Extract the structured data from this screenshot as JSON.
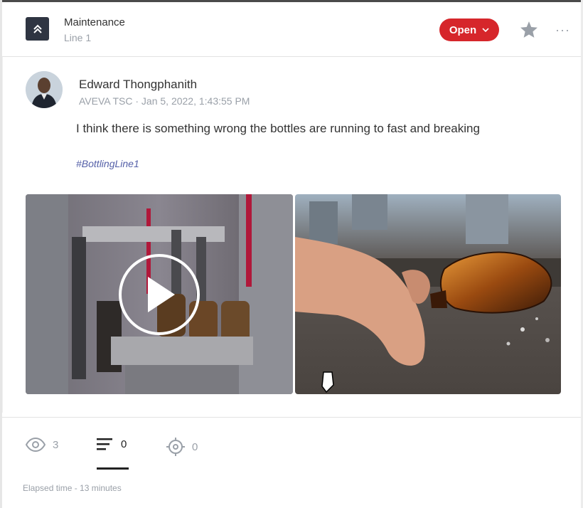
{
  "header": {
    "title": "Maintenance",
    "subtitle": "Line 1",
    "collapse_icon": "double-chevron-up-icon",
    "status_label": "Open",
    "status_color": "#d6262b",
    "star_icon": "star-icon",
    "more_label": "···"
  },
  "post": {
    "author": "Edward Thongphanith",
    "meta": "AVEVA TSC · Jan 5, 2022, 1:43:55 PM",
    "text": "I think there is something wrong the bottles are running to fast and breaking",
    "hashtag": "#BottlingLine1"
  },
  "media": {
    "video_icon": "play-icon",
    "photo_desc_icon": "image"
  },
  "stats": {
    "views": "3",
    "comments": "0",
    "targets": "0"
  },
  "footer": {
    "elapsed": "Elapsed time - 13 minutes"
  }
}
